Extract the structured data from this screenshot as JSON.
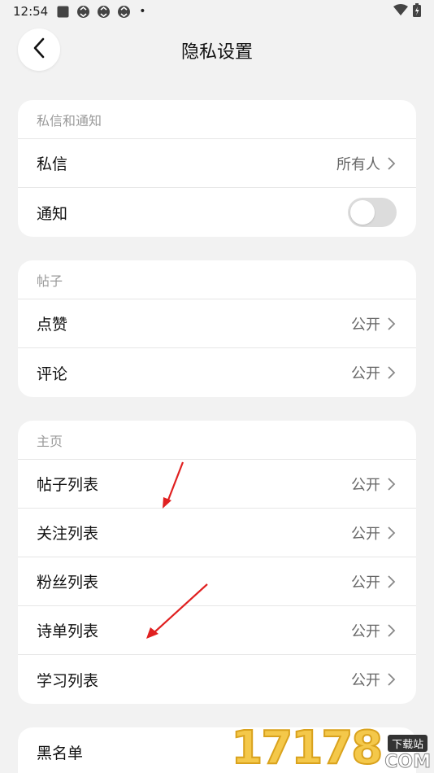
{
  "status_bar": {
    "time": "12:54",
    "icons": [
      "square-icon",
      "sync-icon",
      "sync-icon",
      "sync-icon"
    ],
    "dot": "•"
  },
  "header": {
    "title": "隐私设置"
  },
  "sections": {
    "messages": {
      "header": "私信和通知",
      "rows": [
        {
          "label": "私信",
          "value": "所有人"
        },
        {
          "label": "通知"
        }
      ]
    },
    "posts": {
      "header": "帖子",
      "rows": [
        {
          "label": "点赞",
          "value": "公开"
        },
        {
          "label": "评论",
          "value": "公开"
        }
      ]
    },
    "profile": {
      "header": "主页",
      "rows": [
        {
          "label": "帖子列表",
          "value": "公开"
        },
        {
          "label": "关注列表",
          "value": "公开"
        },
        {
          "label": "粉丝列表",
          "value": "公开"
        },
        {
          "label": "诗单列表",
          "value": "公开"
        },
        {
          "label": "学习列表",
          "value": "公开"
        }
      ]
    },
    "blacklist": {
      "rows": [
        {
          "label": "黑名单"
        }
      ]
    }
  },
  "watermark": {
    "number": "17178",
    "tag": "下载站",
    "suffix": "COM"
  },
  "colors": {
    "background": "#f2f2f2",
    "card": "#ffffff",
    "annotation_arrow": "#e02020"
  }
}
